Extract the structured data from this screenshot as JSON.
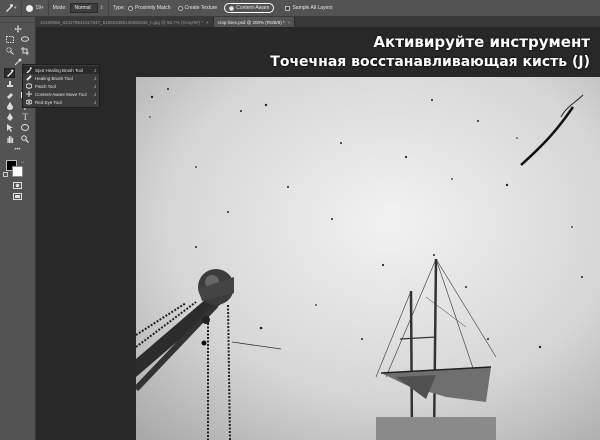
{
  "options_bar": {
    "brush_size": "19",
    "mode_label": "Mode:",
    "mode_value": "Normal",
    "type_label": "Type:",
    "type_options": [
      "Proximity Match",
      "Create Texture",
      "Content-Aware"
    ],
    "selected_type": "Content-Aware",
    "sample_all_layers": "Sample All Layers"
  },
  "tabs": [
    {
      "label": "10480969_823278641017947_518553368126690348_n.jpg @ 66.7% (Gray/8#) *",
      "active": false
    },
    {
      "label": "crop lines.psd @ 200% (RGB/8) *",
      "active": true
    }
  ],
  "flyout": {
    "items": [
      {
        "label": "Spot Healing Brush Tool",
        "key": "J",
        "active": true
      },
      {
        "label": "Healing Brush Tool",
        "key": "J",
        "active": false
      },
      {
        "label": "Patch Tool",
        "key": "J",
        "active": false
      },
      {
        "label": "Content-Aware Move Tool",
        "key": "J",
        "active": false
      },
      {
        "label": "Red Eye Tool",
        "key": "J",
        "active": false
      }
    ]
  },
  "caption": {
    "line1": "Активируйте инструмент",
    "line2": "Точечная восстанавливающая кисть (J)"
  },
  "colors": {
    "foreground": "#000000",
    "background": "#ffffff",
    "accent": "#ffffff"
  }
}
